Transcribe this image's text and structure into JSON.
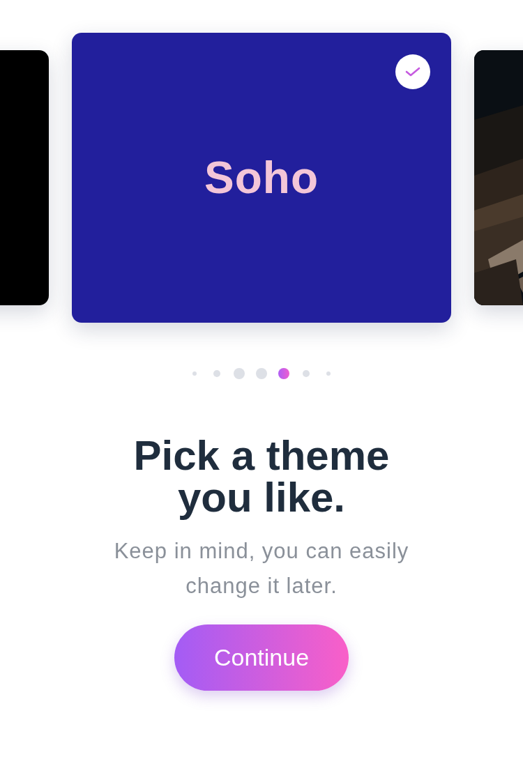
{
  "cards": [
    {
      "kind": "plain",
      "color": "#000000",
      "selected": false
    },
    {
      "kind": "named",
      "title": "Soho",
      "color": "#221f9c",
      "selected": true
    },
    {
      "kind": "picture",
      "selected": false
    }
  ],
  "dots": [
    {
      "selected": false
    },
    {
      "selected": false
    },
    {
      "selected": false
    },
    {
      "selected": false
    },
    {
      "selected": true
    },
    {
      "selected": false
    },
    {
      "selected": false
    }
  ],
  "heading": "Pick a theme you like.",
  "subtitle": "Keep in mind, you can easily change it later.",
  "button": "Continue"
}
